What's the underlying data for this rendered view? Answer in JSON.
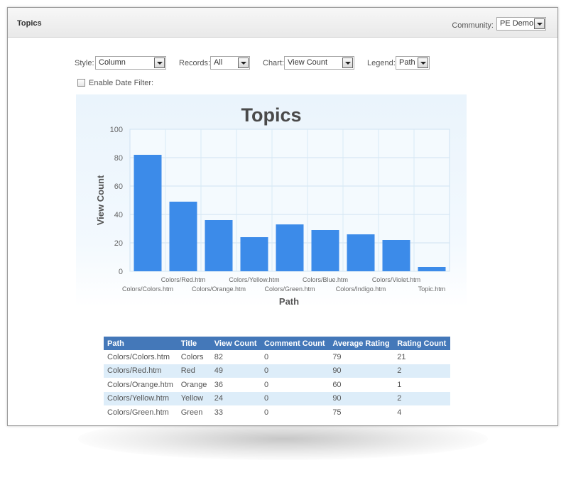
{
  "window": {
    "title": "Topics"
  },
  "community": {
    "label": "Community:",
    "value": "PE Demo"
  },
  "controls": {
    "style": {
      "label": "Style:",
      "value": "Column"
    },
    "records": {
      "label": "Records:",
      "value": "All"
    },
    "chart": {
      "label": "Chart:",
      "value": "View Count"
    },
    "legend": {
      "label": "Legend:",
      "value": "Path"
    },
    "date_filter": {
      "label": "Enable Date Filter:",
      "checked": false
    }
  },
  "chart_data": {
    "type": "bar",
    "title": "Topics",
    "xlabel": "Path",
    "ylabel": "View Count",
    "ylim": [
      0,
      100
    ],
    "yticks": [
      0,
      20,
      40,
      60,
      80,
      100
    ],
    "grid": true,
    "legend": "none",
    "color": "#3c8be9",
    "categories": [
      "Colors/Colors.htm",
      "Colors/Red.htm",
      "Colors/Orange.htm",
      "Colors/Yellow.htm",
      "Colors/Green.htm",
      "Colors/Blue.htm",
      "Colors/Indigo.htm",
      "Colors/Violet.htm",
      "Topic.htm"
    ],
    "values": [
      82,
      49,
      36,
      24,
      33,
      29,
      26,
      22,
      3
    ]
  },
  "table": {
    "columns": [
      "Path",
      "Title",
      "View Count",
      "Comment Count",
      "Average Rating",
      "Rating Count"
    ],
    "rows": [
      [
        "Colors/Colors.htm",
        "Colors",
        "82",
        "0",
        "79",
        "21"
      ],
      [
        "Colors/Red.htm",
        "Red",
        "49",
        "0",
        "90",
        "2"
      ],
      [
        "Colors/Orange.htm",
        "Orange",
        "36",
        "0",
        "60",
        "1"
      ],
      [
        "Colors/Yellow.htm",
        "Yellow",
        "24",
        "0",
        "90",
        "2"
      ],
      [
        "Colors/Green.htm",
        "Green",
        "33",
        "0",
        "75",
        "4"
      ]
    ]
  }
}
